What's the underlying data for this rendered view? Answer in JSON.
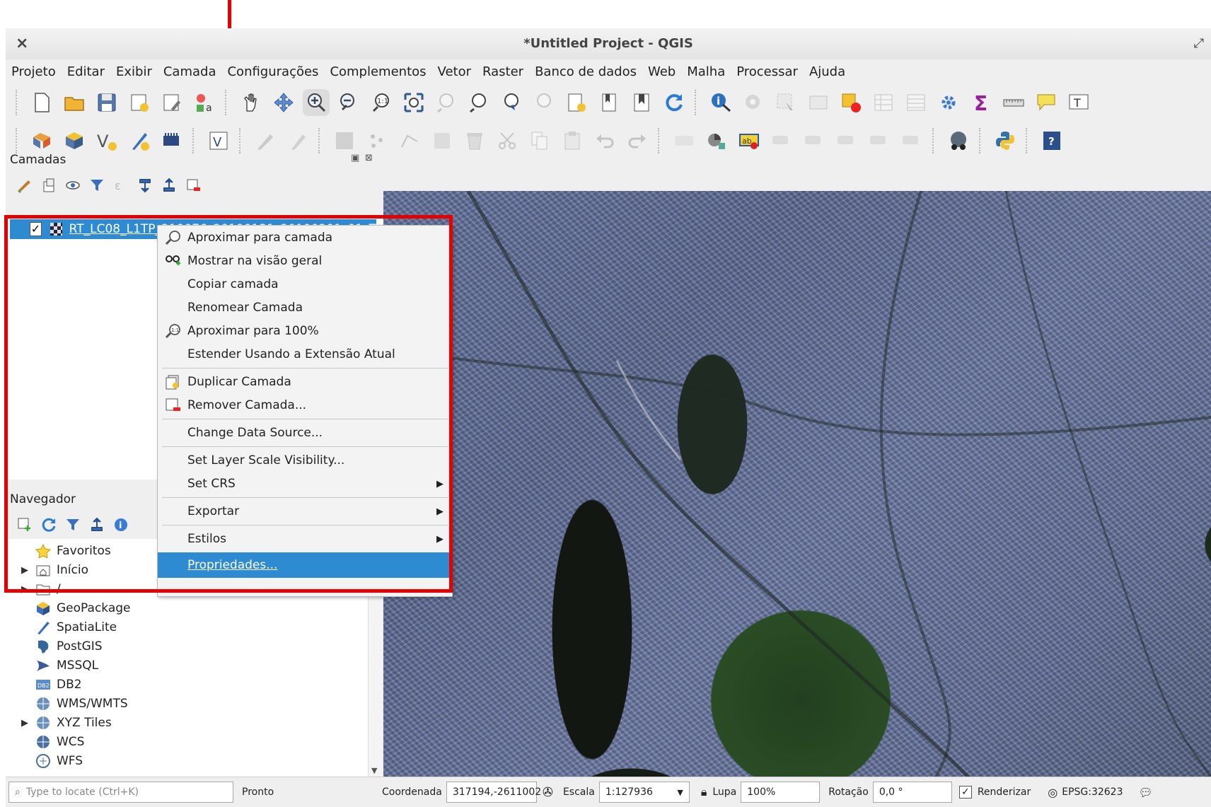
{
  "window": {
    "title": "*Untitled Project - QGIS",
    "close_glyph": "×",
    "maximize_glyph": "⤢"
  },
  "menu": [
    "Projeto",
    "Editar",
    "Exibir",
    "Camada",
    "Configurações",
    "Complementos",
    "Vetor",
    "Raster",
    "Banco de dados",
    "Web",
    "Malha",
    "Processar",
    "Ajuda"
  ],
  "layers_panel": {
    "title": "Camadas",
    "layer_name": "RT_LC08_L1TP_219076_20190131_20190201_01_T"
  },
  "context_menu": {
    "items": [
      {
        "label": "Aproximar para camada",
        "icon": "zoom-layer-icon"
      },
      {
        "label": "Mostrar na visão geral",
        "icon": "overview-icon"
      },
      {
        "label": "Copiar camada",
        "icon": ""
      },
      {
        "label": "Renomear Camada",
        "icon": ""
      },
      {
        "label": "Aproximar para 100%",
        "icon": "zoom-actual-icon"
      },
      {
        "label": "Estender Usando a Extensão Atual",
        "icon": ""
      },
      {
        "label": "Duplicar Camada",
        "icon": "duplicate-layer-icon"
      },
      {
        "label": "Remover Camada...",
        "icon": "remove-layer-icon"
      },
      {
        "label": "Change Data Source...",
        "icon": ""
      },
      {
        "label": "Set Layer Scale Visibility...",
        "icon": ""
      },
      {
        "label": "Set CRS",
        "icon": "",
        "submenu": true
      },
      {
        "label": "Exportar",
        "icon": "",
        "submenu": true
      },
      {
        "label": "Estilos",
        "icon": "",
        "submenu": true
      },
      {
        "label": "Propriedades...",
        "icon": "",
        "selected": true
      }
    ]
  },
  "browser_panel": {
    "title": "Navegador",
    "items": [
      {
        "label": "Favoritos",
        "icon": "star-icon",
        "expandable": false
      },
      {
        "label": "Início",
        "icon": "home-folder-icon",
        "expandable": true
      },
      {
        "label": "/",
        "icon": "folder-icon",
        "expandable": true
      },
      {
        "label": "GeoPackage",
        "icon": "geopackage-icon",
        "expandable": false
      },
      {
        "label": "SpatiaLite",
        "icon": "spatialite-icon",
        "expandable": false
      },
      {
        "label": "PostGIS",
        "icon": "postgis-icon",
        "expandable": false
      },
      {
        "label": "MSSQL",
        "icon": "mssql-icon",
        "expandable": false
      },
      {
        "label": "DB2",
        "icon": "db2-icon",
        "expandable": false
      },
      {
        "label": "WMS/WMTS",
        "icon": "wms-globe-icon",
        "expandable": false
      },
      {
        "label": "XYZ Tiles",
        "icon": "xyz-globe-icon",
        "expandable": true
      },
      {
        "label": "WCS",
        "icon": "wcs-globe-icon",
        "expandable": false
      },
      {
        "label": "WFS",
        "icon": "wfs-globe-icon",
        "expandable": false
      }
    ]
  },
  "status": {
    "locate_placeholder": "Type to locate (Ctrl+K)",
    "message": "Pronto",
    "coord_label": "Coordenada",
    "coord_value": "317194,-2611002",
    "scale_label": "Escala",
    "scale_value": "1:127936",
    "magnifier_label": "Lupa",
    "magnifier_value": "100%",
    "rotation_label": "Rotação",
    "rotation_value": "0,0 °",
    "render_label": "Renderizar",
    "crs": "EPSG:32623"
  },
  "colors": {
    "highlight_red": "#e60000",
    "selection_blue": "#2f8bd1"
  }
}
